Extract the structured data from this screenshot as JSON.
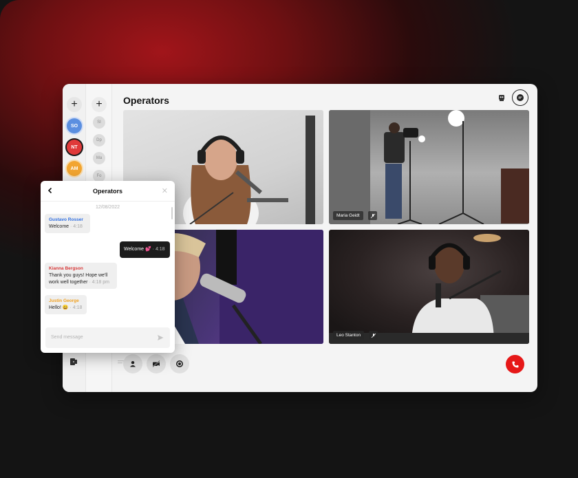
{
  "colors": {
    "accent_red": "#e61818",
    "avatar_so": "#5b8fe0",
    "avatar_nt": "#e03a3a",
    "avatar_am": "#f2a531",
    "sender_blue": "#2f6ee0",
    "sender_red": "#d73838",
    "sender_orange": "#f0a020"
  },
  "header": {
    "title": "Operators"
  },
  "rail": {
    "add_label": "+",
    "avatars": [
      "SO",
      "NT",
      "AM"
    ],
    "secondary": [
      "SI",
      "Dp",
      "Ma",
      "Fo"
    ]
  },
  "tiles": [
    {
      "name": ""
    },
    {
      "name": "Maria Geidt"
    },
    {
      "name": ""
    },
    {
      "name": "Leo Stanton"
    }
  ],
  "controls": {
    "icons": [
      "user-icon",
      "video-off-icon",
      "record-icon"
    ],
    "end_call_icon": "phone-icon"
  },
  "chat": {
    "title": "Operators",
    "date": "12/08/2022",
    "messages": [
      {
        "sender": "Gustavo Rosser",
        "text": "Welcome",
        "time": "4:18",
        "direction": "in"
      },
      {
        "sender": "",
        "text": "Welcome 💕",
        "time": "4:18",
        "direction": "out"
      },
      {
        "sender": "Kianna Bergson",
        "text": "Thank you guys! Hope we'll work well together",
        "time": "4:18 pm",
        "direction": "in"
      },
      {
        "sender": "Justin George",
        "text": "Hello! 😀",
        "time": "4:18",
        "direction": "in"
      }
    ],
    "input_placeholder": "Send message"
  }
}
